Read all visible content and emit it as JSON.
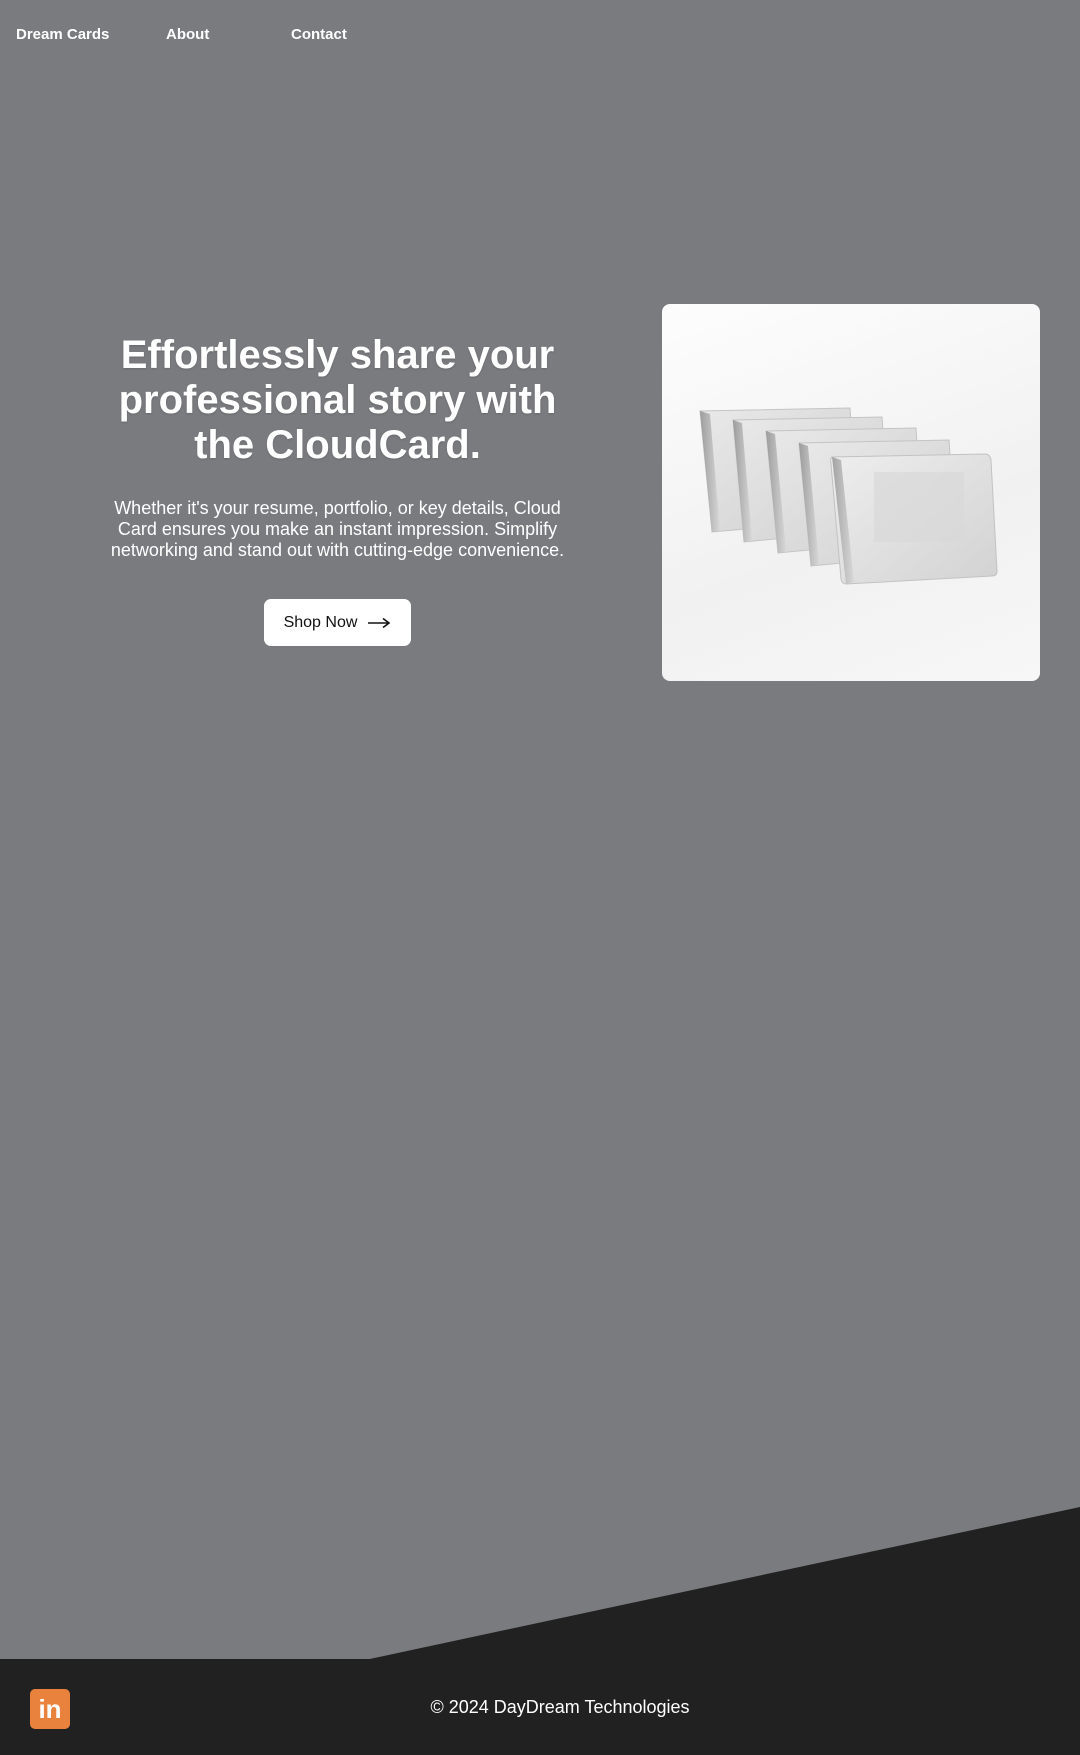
{
  "nav": {
    "brand": "Dream Cards",
    "about": "About",
    "contact": "Contact"
  },
  "hero": {
    "title": "Effortlessly share your professional story with the CloudCard.",
    "description": "Whether it's your resume, portfolio, or key details, Cloud Card ensures you make an instant impression. Simplify networking and stand out with cutting-edge convenience.",
    "cta_label": "Shop Now",
    "cta_icon": "arrow-right-icon"
  },
  "product_image": {
    "description_icon": "stacked-cards-icon"
  },
  "footer": {
    "social_icon": "linkedin-icon",
    "social_text": "in",
    "copyright": "© 2024 DayDream Technologies"
  },
  "colors": {
    "background": "#7a7b7f",
    "footer": "#212121",
    "linkedin": "#e8823c",
    "button": "#ffffff",
    "text": "#ffffff"
  }
}
